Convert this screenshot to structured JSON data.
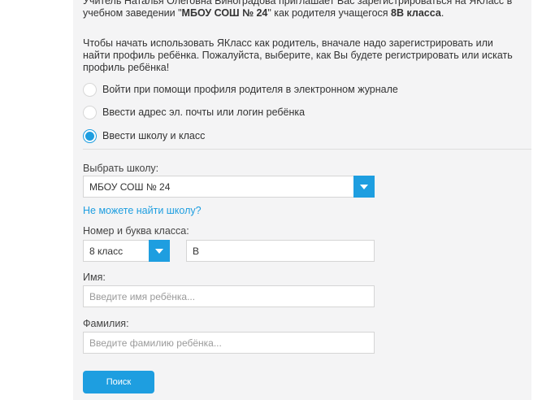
{
  "intro": {
    "line1_cut": "Учитель Наталья Олеговна Виноградова приглашает Вас зарегистрироваться на ЯКласс в",
    "line2_prefix": "учебном заведении \"",
    "school_bold": "МБОУ СОШ № 24",
    "line2_middle": "\" как родителя учащегося ",
    "class_bold": "8В класса",
    "line2_suffix": ".",
    "paragraph2": "Чтобы начать использовать ЯКласс как родитель, вначале надо зарегистрировать или найти профиль ребёнка. Пожалуйста, выберите, как Вы будете регистрировать или искать профиль ребёнка!"
  },
  "options": [
    {
      "label": "Войти при помощи профиля родителя в электронном журнале",
      "checked": false
    },
    {
      "label": "Ввести адрес эл. почты или логин ребёнка",
      "checked": false
    },
    {
      "label": "Ввести школу и класс",
      "checked": true
    }
  ],
  "school": {
    "label": "Выбрать школу:",
    "value": "МБОУ СОШ № 24",
    "not_found_link": "Не можете найти школу?"
  },
  "class_number": {
    "label": "Номер и буква класса:",
    "grade_value": "8 класс",
    "letter_value": "В"
  },
  "first_name": {
    "label": "Имя:",
    "placeholder": "Введите имя ребёнка..."
  },
  "last_name": {
    "label": "Фамилия:",
    "placeholder": "Введите фамилию ребёнка..."
  },
  "submit_label": "Поиск",
  "colors": {
    "accent": "#1e9ee0",
    "panel_bg": "#f4f4f5"
  }
}
